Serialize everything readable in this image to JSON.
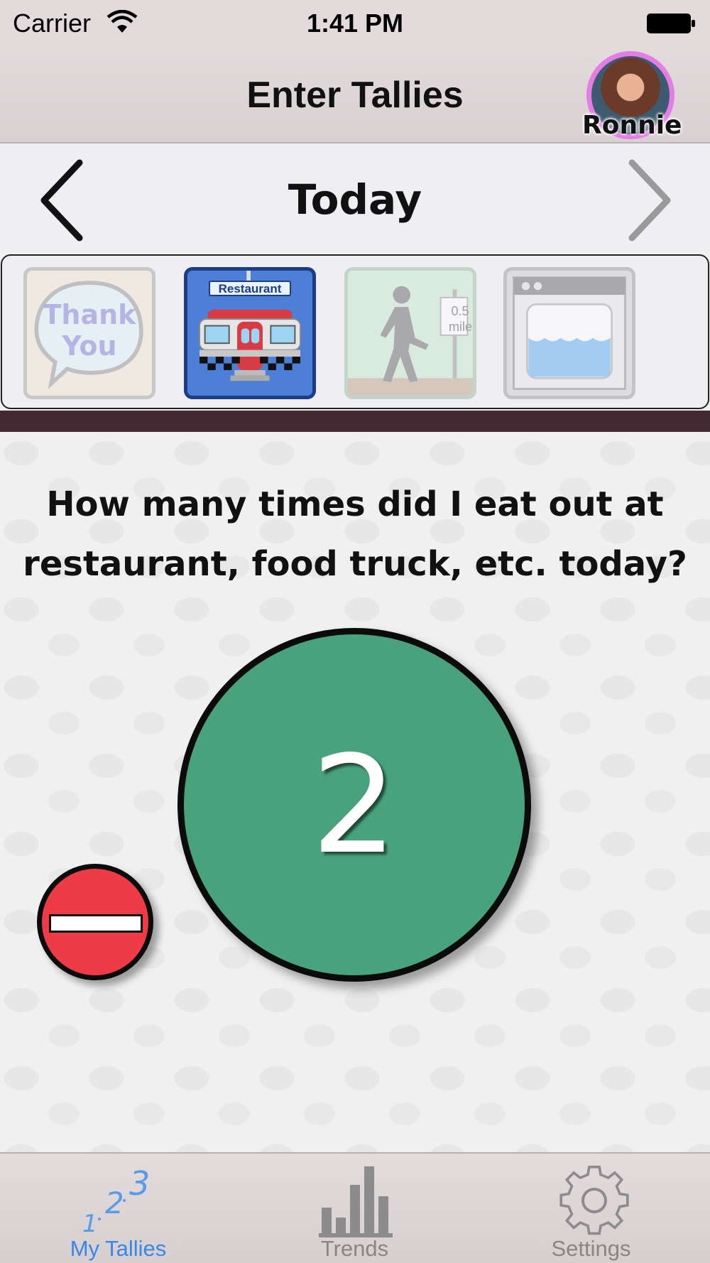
{
  "status_bar": {
    "carrier": "Carrier",
    "time": "1:41 PM"
  },
  "nav": {
    "title": "Enter Tallies",
    "profile_name": "Ronnie"
  },
  "date_nav": {
    "label": "Today"
  },
  "tallies": [
    {
      "name": "thank-you",
      "label": "Thank You",
      "selected": false
    },
    {
      "name": "restaurant",
      "label": "Restaurant",
      "selected": true
    },
    {
      "name": "walk",
      "sign": "0.5 miles",
      "selected": false
    },
    {
      "name": "oven",
      "selected": false
    }
  ],
  "question": "How many times did I eat out at restaurant, food truck, etc.  today?",
  "count": "2",
  "colors": {
    "count_circle": "#48a27c",
    "minus_button": "#ee3b48",
    "active_tab": "#3a87e5",
    "separator": "#432a32"
  },
  "tabs": [
    {
      "label": "My Tallies",
      "icon": "tallies-icon",
      "active": true
    },
    {
      "label": "Trends",
      "icon": "bar-chart-icon",
      "active": false
    },
    {
      "label": "Settings",
      "icon": "gear-icon",
      "active": false
    }
  ],
  "tab_icon_text": {
    "one": "1",
    "two": "2",
    "three": "3"
  }
}
